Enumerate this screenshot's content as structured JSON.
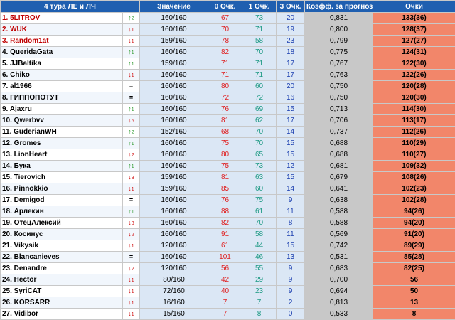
{
  "header": {
    "title": "4 тура ЛЕ и ЛЧ",
    "value": "Значение",
    "zero": "0 Очк.",
    "one": "1 Очк.",
    "three": "3 Очк.",
    "coef": "Коэфф. за прогноз",
    "points": "Очки"
  },
  "rows": [
    {
      "name": "1. 5LITROV",
      "trend": "up",
      "arrow": "↑",
      "delta": "2",
      "value": "160/160",
      "zero": "67",
      "one": "73",
      "three": "20",
      "coef": "0,831",
      "points": "133(36)",
      "top": true
    },
    {
      "name": "2. WUK",
      "trend": "down",
      "arrow": "↓",
      "delta": "1",
      "value": "160/160",
      "zero": "70",
      "one": "71",
      "three": "19",
      "coef": "0,800",
      "points": "128(37)",
      "top": true
    },
    {
      "name": "3. Random1at",
      "trend": "down",
      "arrow": "↓",
      "delta": "1",
      "value": "159/160",
      "zero": "78",
      "one": "58",
      "three": "23",
      "coef": "0,799",
      "points": "127(27)",
      "top": true
    },
    {
      "name": "4. QueridaGata",
      "trend": "up",
      "arrow": "↑",
      "delta": "1",
      "value": "160/160",
      "zero": "82",
      "one": "70",
      "three": "18",
      "coef": "0,775",
      "points": "124(31)",
      "top": false
    },
    {
      "name": "5. JJBaltika",
      "trend": "up",
      "arrow": "↑",
      "delta": "1",
      "value": "159/160",
      "zero": "71",
      "one": "71",
      "three": "17",
      "coef": "0,767",
      "points": "122(30)",
      "top": false
    },
    {
      "name": "6. Chiko",
      "trend": "down",
      "arrow": "↓",
      "delta": "1",
      "value": "160/160",
      "zero": "71",
      "one": "71",
      "three": "17",
      "coef": "0,763",
      "points": "122(26)",
      "top": false
    },
    {
      "name": "7. al1966",
      "trend": "eq",
      "arrow": "=",
      "delta": "",
      "value": "160/160",
      "zero": "80",
      "one": "60",
      "three": "20",
      "coef": "0,750",
      "points": "120(28)",
      "top": false
    },
    {
      "name": "8. ГИППОПОТУТ",
      "trend": "eq",
      "arrow": "=",
      "delta": "",
      "value": "160/160",
      "zero": "72",
      "one": "72",
      "three": "16",
      "coef": "0,750",
      "points": "120(30)",
      "top": false
    },
    {
      "name": "9. Ajaxru",
      "trend": "up",
      "arrow": "↑",
      "delta": "1",
      "value": "160/160",
      "zero": "76",
      "one": "69",
      "three": "15",
      "coef": "0,713",
      "points": "114(30)",
      "top": false
    },
    {
      "name": "10. Qwerbvv",
      "trend": "down",
      "arrow": "↓",
      "delta": "6",
      "value": "160/160",
      "zero": "81",
      "one": "62",
      "three": "17",
      "coef": "0,706",
      "points": "113(17)",
      "top": false
    },
    {
      "name": "11. GuderianWH",
      "trend": "up",
      "arrow": "↑",
      "delta": "2",
      "value": "152/160",
      "zero": "68",
      "one": "70",
      "three": "14",
      "coef": "0,737",
      "points": "112(26)",
      "top": false
    },
    {
      "name": "12. Gromes",
      "trend": "up",
      "arrow": "↑",
      "delta": "1",
      "value": "160/160",
      "zero": "75",
      "one": "70",
      "three": "15",
      "coef": "0,688",
      "points": "110(29)",
      "top": false
    },
    {
      "name": "13. LionHeart",
      "trend": "down",
      "arrow": "↓",
      "delta": "2",
      "value": "160/160",
      "zero": "80",
      "one": "65",
      "three": "15",
      "coef": "0,688",
      "points": "110(27)",
      "top": false
    },
    {
      "name": "14. Бука",
      "trend": "up",
      "arrow": "↑",
      "delta": "1",
      "value": "160/160",
      "zero": "75",
      "one": "73",
      "three": "12",
      "coef": "0,681",
      "points": "109(32)",
      "top": false
    },
    {
      "name": "15. Tierovich",
      "trend": "down",
      "arrow": "↓",
      "delta": "3",
      "value": "159/160",
      "zero": "81",
      "one": "63",
      "three": "15",
      "coef": "0,679",
      "points": "108(26)",
      "top": false
    },
    {
      "name": "16. Pinnokkio",
      "trend": "down",
      "arrow": "↓",
      "delta": "1",
      "value": "159/160",
      "zero": "85",
      "one": "60",
      "three": "14",
      "coef": "0,641",
      "points": "102(23)",
      "top": false
    },
    {
      "name": "17. Demigod",
      "trend": "eq",
      "arrow": "=",
      "delta": "",
      "value": "160/160",
      "zero": "76",
      "one": "75",
      "three": "9",
      "coef": "0,638",
      "points": "102(28)",
      "top": false
    },
    {
      "name": "18. Арлекин",
      "trend": "up",
      "arrow": "↑",
      "delta": "1",
      "value": "160/160",
      "zero": "88",
      "one": "61",
      "three": "11",
      "coef": "0,588",
      "points": "94(26)",
      "top": false
    },
    {
      "name": "19. ОтецАлексий",
      "trend": "down",
      "arrow": "↓",
      "delta": "3",
      "value": "160/160",
      "zero": "82",
      "one": "70",
      "three": "8",
      "coef": "0,588",
      "points": "94(20)",
      "top": false
    },
    {
      "name": "20. Косинус",
      "trend": "down",
      "arrow": "↓",
      "delta": "2",
      "value": "160/160",
      "zero": "91",
      "one": "58",
      "three": "11",
      "coef": "0,569",
      "points": "91(20)",
      "top": false
    },
    {
      "name": "21. Vikysik",
      "trend": "down",
      "arrow": "↓",
      "delta": "1",
      "value": "120/160",
      "zero": "61",
      "one": "44",
      "three": "15",
      "coef": "0,742",
      "points": "89(29)",
      "top": false
    },
    {
      "name": "22. Blancanieves",
      "trend": "eq",
      "arrow": "=",
      "delta": "",
      "value": "160/160",
      "zero": "101",
      "one": "46",
      "three": "13",
      "coef": "0,531",
      "points": "85(28)",
      "top": false
    },
    {
      "name": "23. Denandre",
      "trend": "down",
      "arrow": "↓",
      "delta": "2",
      "value": "120/160",
      "zero": "56",
      "one": "55",
      "three": "9",
      "coef": "0,683",
      "points": "82(25)",
      "top": false
    },
    {
      "name": "24. Hector",
      "trend": "down",
      "arrow": "↓",
      "delta": "1",
      "value": "80/160",
      "zero": "42",
      "one": "29",
      "three": "9",
      "coef": "0,700",
      "points": "56",
      "top": false
    },
    {
      "name": "25. SyriCAT",
      "trend": "down",
      "arrow": "↓",
      "delta": "1",
      "value": "72/160",
      "zero": "40",
      "one": "23",
      "three": "9",
      "coef": "0,694",
      "points": "50",
      "top": false
    },
    {
      "name": "26. KORSARR",
      "trend": "down",
      "arrow": "↓",
      "delta": "1",
      "value": "16/160",
      "zero": "7",
      "one": "7",
      "three": "2",
      "coef": "0,813",
      "points": "13",
      "top": false
    },
    {
      "name": "27. Vidibor",
      "trend": "down",
      "arrow": "↓",
      "delta": "1",
      "value": "15/160",
      "zero": "7",
      "one": "8",
      "three": "0",
      "coef": "0,533",
      "points": "8",
      "top": false
    }
  ]
}
